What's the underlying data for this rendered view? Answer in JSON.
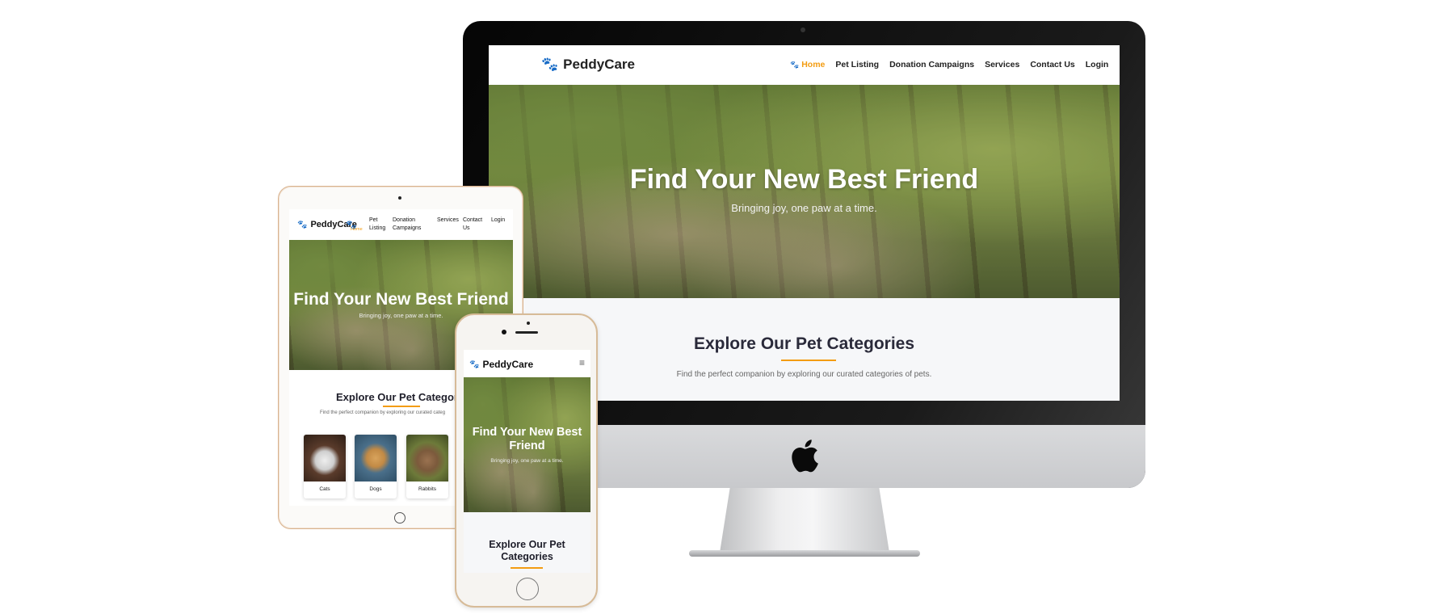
{
  "site": {
    "brand": "PeddyCare",
    "hero_title": "Find Your New Best Friend",
    "hero_subtitle": "Bringing joy, one paw at a time.",
    "section_title": "Explore Our Pet Categories",
    "section_subtitle": "Find the perfect companion by exploring our curated categories of pets."
  },
  "desktop_nav": {
    "home": "Home",
    "items": [
      "Pet Listing",
      "Donation Campaigns",
      "Services",
      "Contact Us",
      "Login"
    ]
  },
  "tablet_nav": {
    "home": "Home",
    "pet_listing": [
      "Pet",
      "Listing"
    ],
    "donation": [
      "Donation",
      "Campaigns"
    ],
    "services": "Services",
    "contact": [
      "Contact",
      "Us"
    ],
    "login": "Login"
  },
  "tablet": {
    "section_title_visible": "Explore Our Pet Categor",
    "section_subtitle_visible": "Find the perfect companion by exploring our curated categ",
    "categories": [
      "Cats",
      "Dogs",
      "Rabbits"
    ]
  },
  "mobile": {
    "hero_title_lines": [
      "Find Your New Best",
      "Friend"
    ],
    "section_title_lines": [
      "Explore Our Pet",
      "Categories"
    ],
    "menu_icon": "hamburger-icon"
  },
  "colors": {
    "accent": "#f39c12",
    "brand_paw": "#8e5fc0",
    "heading": "#2a2a3a"
  },
  "icons": {
    "brand": "paw-icon",
    "device_logo": "apple-logo-icon"
  }
}
